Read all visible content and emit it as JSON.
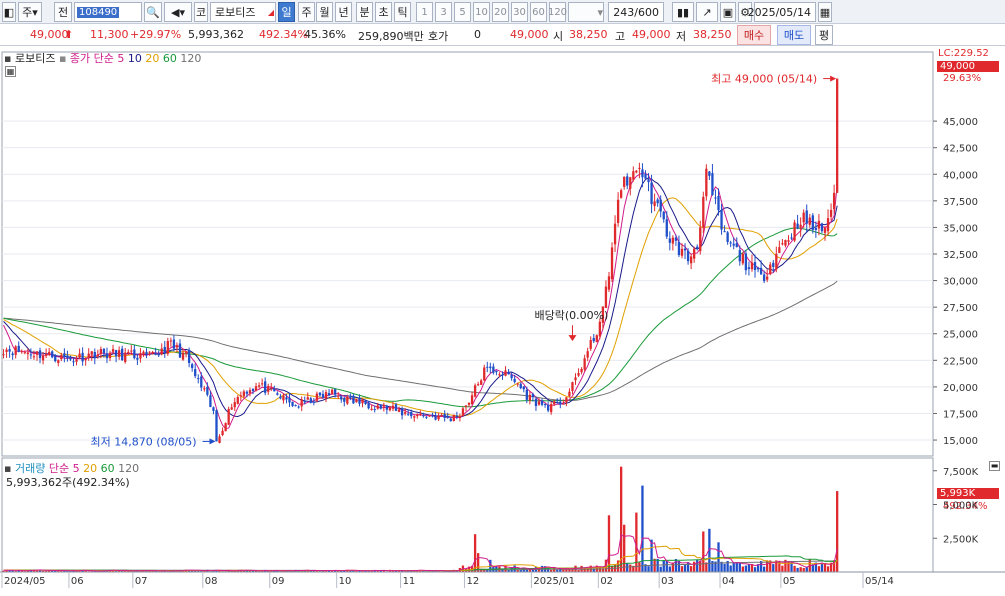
{
  "toolbar": {
    "market_label": "주",
    "prev_label": "전",
    "code": "108490",
    "market_code": "코",
    "stock_name": "로보티즈",
    "periods": [
      "일",
      "주",
      "월",
      "년",
      "분",
      "초",
      "틱"
    ],
    "active_period": "일",
    "intervals": [
      "1",
      "3",
      "5",
      "10",
      "20",
      "30",
      "60",
      "120"
    ],
    "count": "243/600",
    "date": "2025/05/14"
  },
  "quote": {
    "price": "49,000",
    "change": "11,300",
    "change_pct": "+29.97%",
    "volume": "5,993,362",
    "volume_ratio": "492.34%",
    "turnover": "45.36%",
    "amount": "259,890백만",
    "hoga_label": "호가",
    "hoga_value": "0",
    "ask": "49,000",
    "open_label": "시",
    "open": "38,250",
    "high_label": "고",
    "high": "49,000",
    "low_label": "저",
    "low": "38,250",
    "buy_label": "매수",
    "sell_label": "매도",
    "flat_label": "평"
  },
  "legend": {
    "name": "로보티즈",
    "ma_label": "종가 단순 5",
    "ma_periods": [
      "10",
      "20",
      "60",
      "120"
    ],
    "vol_name": "거래량",
    "vol_ma_label": "단순 5",
    "vol_ma_periods": [
      "20",
      "60",
      "120"
    ],
    "vol_current": "5,993,362주(492.34%)"
  },
  "axis_tags": {
    "lc": "LC:229.52",
    "price": "49,000",
    "pct": "29.63%",
    "vol": "5,993K",
    "vol_pct": "492.34%"
  },
  "annotations": {
    "high": "최고 49,000 (05/14)",
    "low": "최저 14,870 (08/05)",
    "dividend": "배당락(0.00%)"
  },
  "colors": {
    "up": "#e0292d",
    "down": "#1f4fc9",
    "ma5": "#d01c8b",
    "ma10": "#1a1a8a",
    "ma20": "#e0a000",
    "ma60": "#1a9a3a",
    "ma120": "#707070"
  },
  "chart_data": {
    "type": "candlestick",
    "price_axis": {
      "ticks": [
        "45,000",
        "42,500",
        "40,000",
        "37,500",
        "35,000",
        "32,500",
        "30,000",
        "27,500",
        "25,000",
        "22,500",
        "20,000",
        "17,500",
        "15,000"
      ],
      "ylim": [
        13500,
        51500
      ]
    },
    "volume_axis": {
      "ticks": [
        "7,500K",
        "5,000K",
        "2,500K"
      ],
      "ylim": [
        0,
        8000000
      ]
    },
    "x_labels": [
      "2024/05",
      "06",
      "07",
      "08",
      "09",
      "10",
      "11",
      "12",
      "2025/01",
      "02",
      "03",
      "04",
      "05",
      "05/14"
    ],
    "close_anchors": [
      [
        0,
        23600
      ],
      [
        14,
        23000
      ],
      [
        22,
        22600
      ],
      [
        30,
        23200
      ],
      [
        40,
        23000
      ],
      [
        48,
        22800
      ],
      [
        55,
        24000
      ],
      [
        60,
        22800
      ],
      [
        63,
        21000
      ],
      [
        66,
        19500
      ],
      [
        69,
        17500
      ],
      [
        70,
        14870
      ],
      [
        72,
        16200
      ],
      [
        75,
        18400
      ],
      [
        79,
        19600
      ],
      [
        84,
        20100
      ],
      [
        90,
        19200
      ],
      [
        96,
        18200
      ],
      [
        101,
        18800
      ],
      [
        108,
        19400
      ],
      [
        114,
        18700
      ],
      [
        120,
        18400
      ],
      [
        126,
        18000
      ],
      [
        132,
        17500
      ],
      [
        140,
        17300
      ],
      [
        147,
        17000
      ],
      [
        150,
        17500
      ],
      [
        154,
        19200
      ],
      [
        158,
        21500
      ],
      [
        162,
        21600
      ],
      [
        166,
        21000
      ],
      [
        169,
        20300
      ],
      [
        172,
        19200
      ],
      [
        176,
        18400
      ],
      [
        180,
        18100
      ],
      [
        184,
        18700
      ],
      [
        187,
        20000
      ],
      [
        190,
        22000
      ],
      [
        194,
        24500
      ],
      [
        197,
        27000
      ],
      [
        199,
        31000
      ],
      [
        202,
        37000
      ],
      [
        204,
        40000
      ],
      [
        206,
        39000
      ],
      [
        208,
        41000
      ],
      [
        210,
        40000
      ],
      [
        213,
        38000
      ],
      [
        216,
        36000
      ],
      [
        219,
        34000
      ],
      [
        222,
        33000
      ],
      [
        225,
        32000
      ],
      [
        228,
        33500
      ],
      [
        231,
        40000
      ],
      [
        234,
        37000
      ],
      [
        237,
        34000
      ],
      [
        240,
        33000
      ],
      [
        243,
        32000
      ],
      [
        246,
        31000
      ],
      [
        249,
        30200
      ],
      [
        252,
        31500
      ],
      [
        256,
        33500
      ],
      [
        259,
        34500
      ],
      [
        262,
        36000
      ],
      [
        266,
        35000
      ],
      [
        270,
        35000
      ],
      [
        272,
        37000
      ],
      [
        273,
        38250
      ],
      [
        274,
        49000
      ]
    ],
    "volume_spikes": [
      [
        155,
        2800000
      ],
      [
        156,
        1400000
      ],
      [
        160,
        900000
      ],
      [
        199,
        4200000
      ],
      [
        203,
        7800000
      ],
      [
        204,
        3500000
      ],
      [
        208,
        4400000
      ],
      [
        210,
        6400000
      ],
      [
        213,
        2400000
      ],
      [
        230,
        3000000
      ],
      [
        232,
        3200000
      ],
      [
        235,
        2200000
      ],
      [
        274,
        5993362
      ]
    ],
    "max_label": "최고 49,000 (05/14)",
    "min_label": "최저 14,870 (08/05)"
  }
}
